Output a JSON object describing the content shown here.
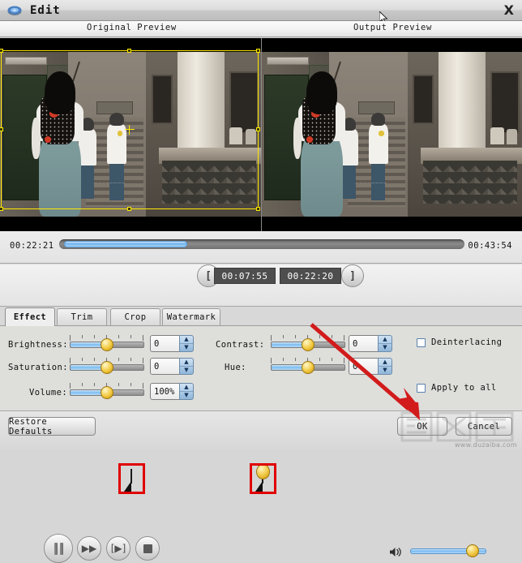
{
  "window": {
    "title": "Edit",
    "icon": "disc-icon",
    "close_label": "X"
  },
  "preview": {
    "original_label": "Original Preview",
    "output_label": "Output Preview",
    "crop_overlay_color": "#ffe800"
  },
  "timeline": {
    "start_time": "00:22:21",
    "end_time": "00:43:54",
    "fill_color": "#6db3ee",
    "marker_highlight_color": "#e00000"
  },
  "transport": {
    "pause_label": "pause-button",
    "forward_label": "▶▶",
    "frame_label": "[▶]",
    "stop_label": "stop-button",
    "mark_in_label": "[",
    "mark_out_label": "]",
    "trim_start": "00:07:55",
    "trim_end": "00:22:20",
    "volume_level": "100"
  },
  "tabs": [
    {
      "label": "Effect",
      "active": true
    },
    {
      "label": "Trim",
      "active": false
    },
    {
      "label": "Crop",
      "active": false
    },
    {
      "label": "Watermark",
      "active": false
    }
  ],
  "effect": {
    "brightness": {
      "label": "Brightness:",
      "value": "0"
    },
    "saturation": {
      "label": "Saturation:",
      "value": "0"
    },
    "volume": {
      "label": "Volume:",
      "value": "100%"
    },
    "contrast": {
      "label": "Contrast:",
      "value": "0"
    },
    "hue": {
      "label": "Hue:",
      "value": "0"
    },
    "deinterlacing": {
      "label": "Deinterlacing",
      "checked": false
    },
    "apply_to_all": {
      "label": "Apply to all",
      "checked": false
    }
  },
  "footer": {
    "restore_label": "Restore Defaults",
    "ok_label": "OK",
    "cancel_label": "Cancel"
  },
  "watermark": {
    "site": "www.duzaiba.com"
  },
  "spinner": {
    "up": "▲",
    "down": "▼"
  }
}
